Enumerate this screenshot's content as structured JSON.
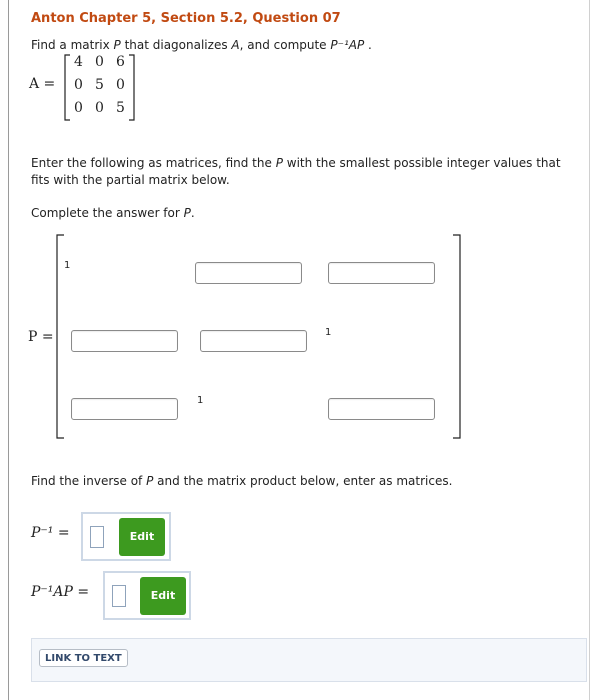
{
  "title": "Anton Chapter 5, Section 5.2, Question 07",
  "prompt": {
    "prefix": "Find a matrix ",
    "P": "P",
    "middle": " that diagonalizes ",
    "A": "A",
    "suffix": ", and compute ",
    "expr": "P⁻¹AP",
    "end": " ."
  },
  "matrix_A": {
    "label": "A =",
    "rows": [
      [
        "4",
        "0",
        "6"
      ],
      [
        "0",
        "5",
        "0"
      ],
      [
        "0",
        "0",
        "5"
      ]
    ]
  },
  "instructions": {
    "line1_a": "Enter the following as matrices, find the ",
    "line1_P": "P",
    "line1_b": " with the smallest possible integer values that",
    "line2": "fits with the partial matrix below.",
    "complete_a": "Complete the answer for ",
    "complete_P": "P",
    "complete_b": "."
  },
  "matrix_P": {
    "label": "P =",
    "r1c1": "1",
    "r2c3": "1",
    "r3c2": "1"
  },
  "inverse_section": {
    "text_a": "Find the inverse of ",
    "text_P": "P",
    "text_b": " and the matrix product below, enter as matrices.",
    "p_inv_label": "P⁻¹ =",
    "product_label": "P⁻¹AP =",
    "edit_label": "Edit"
  },
  "link_to_text": "LINK TO TEXT",
  "colors": {
    "title": "#c14a12",
    "edit_button": "#3d9a1f",
    "link_text": "#32496b"
  }
}
